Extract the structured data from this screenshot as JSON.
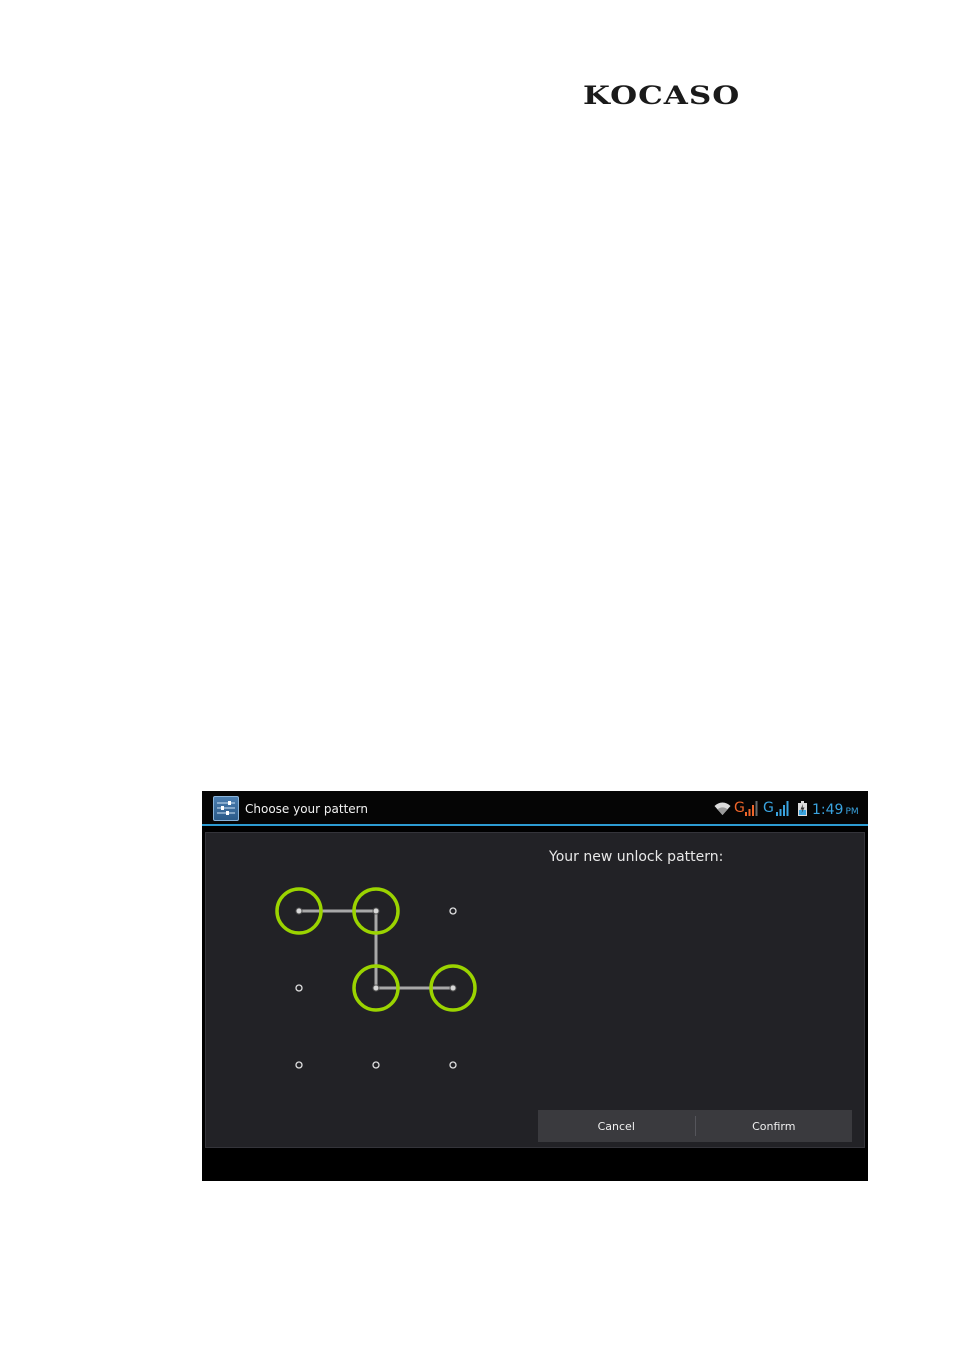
{
  "logo": {
    "text": "KOCASO"
  },
  "action_bar": {
    "title": "Choose your pattern",
    "app_icon": "settings-sliders-icon"
  },
  "status_bar": {
    "icons": [
      "wifi-icon",
      "signal-g-icon",
      "signal-bars-icon",
      "signal-g-icon",
      "signal-bars-icon",
      "battery-charging-icon"
    ],
    "network_g_1": "G",
    "network_g_2": "G",
    "time": "1:49",
    "ampm": "PM",
    "colors": {
      "accent": "#2d9bd2",
      "signal_orange": "#f0652a",
      "signal_blue": "#3aa4e0",
      "pattern_ring": "#9bd400"
    }
  },
  "main": {
    "header_text": "Your new unlock pattern:",
    "pattern": {
      "grid": "3x3",
      "selected_dots": [
        1,
        2,
        5,
        6
      ],
      "sequence": [
        1,
        2,
        5,
        6
      ]
    }
  },
  "buttons": {
    "cancel_label": "Cancel",
    "confirm_label": "Confirm"
  }
}
